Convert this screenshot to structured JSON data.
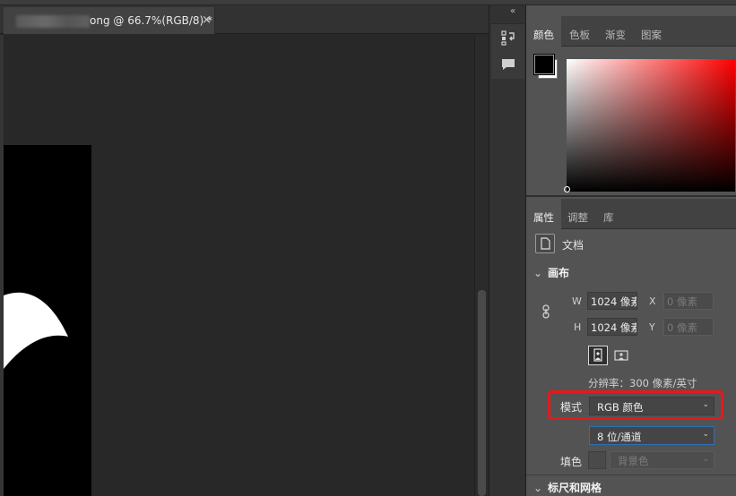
{
  "document": {
    "tab_title": "ong @ 66.7%(RGB/8) *",
    "close_glyph": "×"
  },
  "iconstrip": {
    "collapse_glyph": "«",
    "icons": [
      "history-icon",
      "comment-icon"
    ]
  },
  "color_panel": {
    "tabs": [
      "颜色",
      "色板",
      "渐变",
      "图案"
    ],
    "active_tab": "颜色",
    "foreground": "#000000",
    "background": "#ffffff",
    "hue": "#ff0000"
  },
  "properties_panel": {
    "tabs": [
      "属性",
      "调整",
      "库"
    ],
    "active_tab": "属性",
    "doc_label": "文档",
    "canvas_section": "画布",
    "width_label": "W",
    "width_value": "1024 像素",
    "height_label": "H",
    "height_value": "1024 像素",
    "x_label": "X",
    "x_placeholder": "0 像素",
    "y_label": "Y",
    "y_placeholder": "0 像素",
    "resolution": "分辨率：300 像素/英寸",
    "mode_label": "模式",
    "mode_value": "RGB 颜色",
    "depth_value": "8 位/通道",
    "fill_label": "填色",
    "fill_value": "背景色",
    "rulers_section": "标尺和网格"
  },
  "colors": {
    "highlight": "#e5191c",
    "focus_border": "#2f6fb7"
  }
}
